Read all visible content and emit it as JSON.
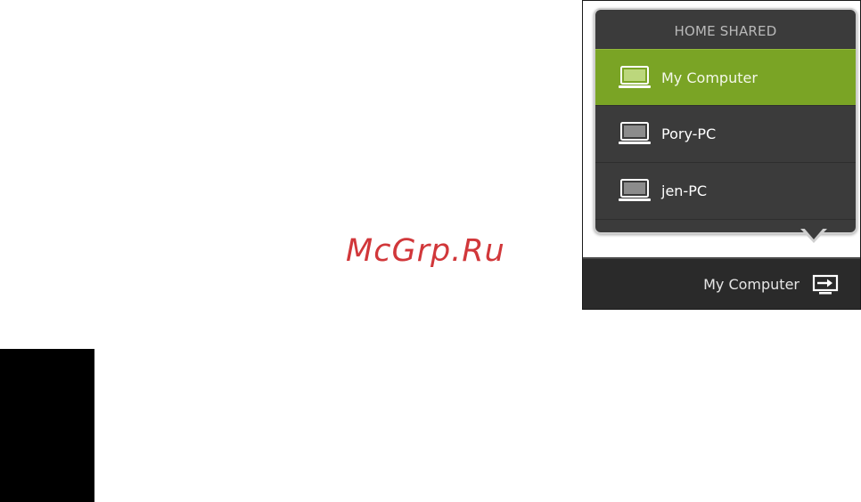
{
  "watermark": "McGrp.Ru",
  "popup": {
    "header": "HOME SHARED",
    "devices": [
      {
        "label": "My Computer",
        "icon": "laptop-icon",
        "selected": true
      },
      {
        "label": "Pory-PC",
        "icon": "laptop-icon",
        "selected": false
      },
      {
        "label": "jen-PC",
        "icon": "laptop-icon",
        "selected": false
      }
    ]
  },
  "bottom_bar": {
    "label": "My Computer",
    "icon": "switch-source-icon"
  },
  "colors": {
    "selected": "#7aa425",
    "popup_bg": "#3b3b3b",
    "bar_bg": "#2a2a2a",
    "watermark": "#d1373a"
  }
}
